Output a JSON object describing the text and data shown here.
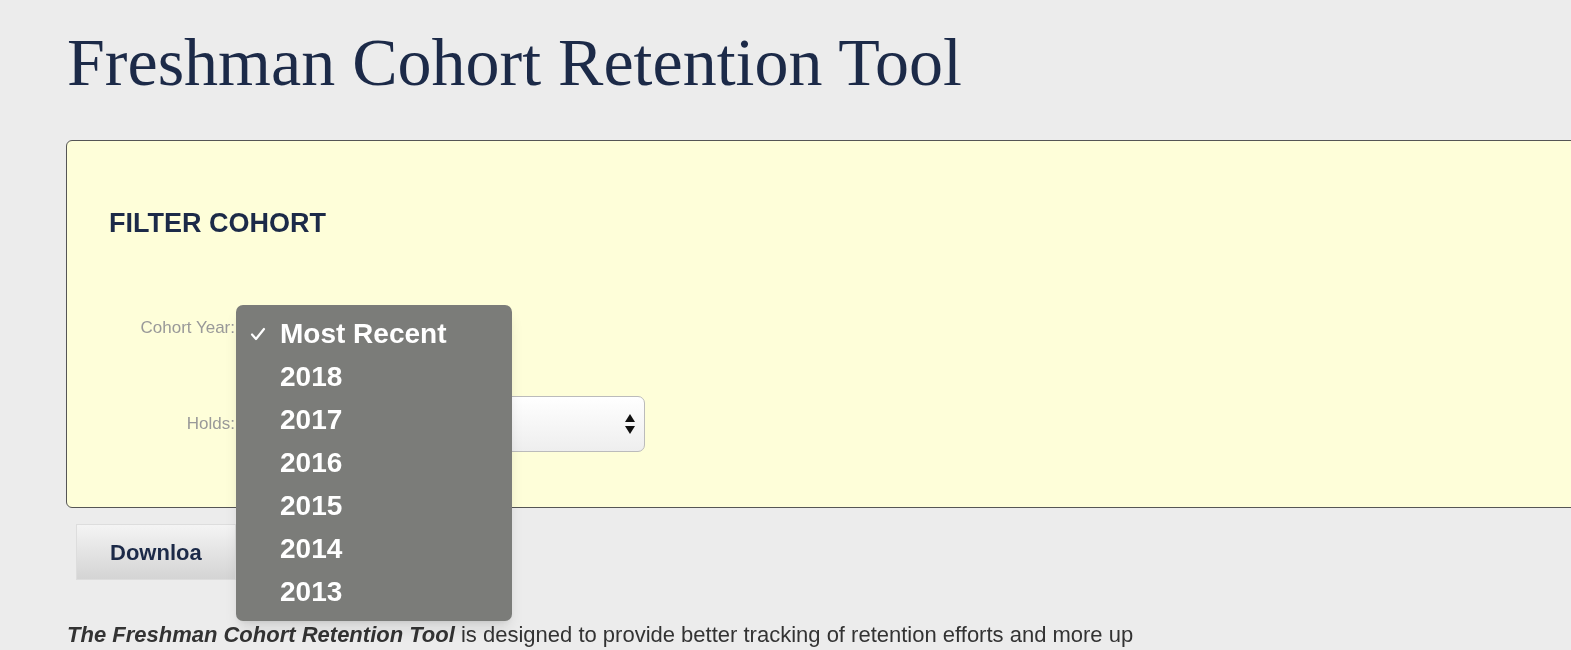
{
  "title": "Freshman Cohort Retention Tool",
  "filter": {
    "heading": "FILTER COHORT",
    "fields": [
      {
        "label": "Cohort Year:",
        "kind": "covered"
      },
      {
        "label": "Holds:",
        "kind": "select"
      }
    ]
  },
  "dropdown": {
    "options": [
      {
        "label": "Most Recent",
        "selected": true
      },
      {
        "label": "2018",
        "selected": false
      },
      {
        "label": "2017",
        "selected": false
      },
      {
        "label": "2016",
        "selected": false
      },
      {
        "label": "2015",
        "selected": false
      },
      {
        "label": "2014",
        "selected": false
      },
      {
        "label": "2013",
        "selected": false
      }
    ]
  },
  "download_button": {
    "label": "Downloa"
  },
  "intro": "**The Freshman Cohort Retention Tool** is designed to provide better tracking of retention efforts and more up"
}
